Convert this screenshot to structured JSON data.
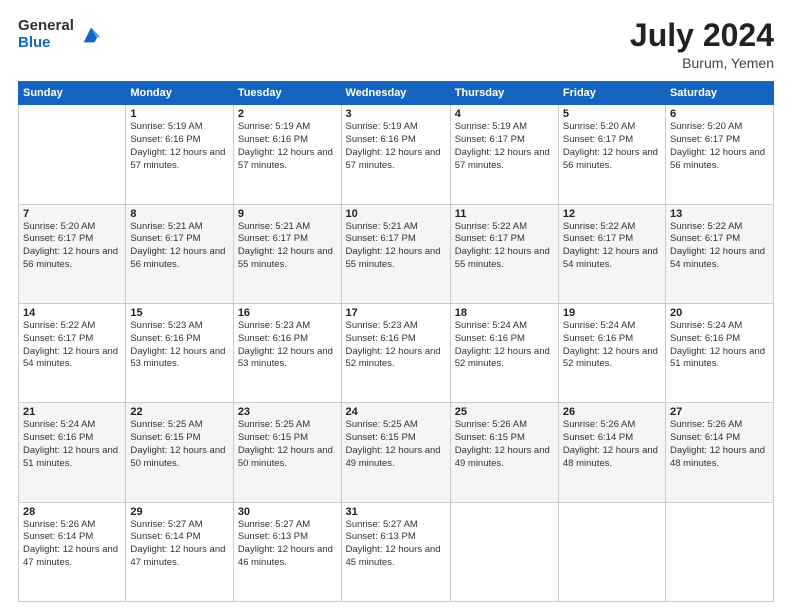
{
  "logo": {
    "general": "General",
    "blue": "Blue"
  },
  "title": {
    "month_year": "July 2024",
    "location": "Burum, Yemen"
  },
  "weekdays": [
    "Sunday",
    "Monday",
    "Tuesday",
    "Wednesday",
    "Thursday",
    "Friday",
    "Saturday"
  ],
  "weeks": [
    [
      {
        "day": "",
        "sunrise": "",
        "sunset": "",
        "daylight": ""
      },
      {
        "day": "1",
        "sunrise": "Sunrise: 5:19 AM",
        "sunset": "Sunset: 6:16 PM",
        "daylight": "Daylight: 12 hours and 57 minutes."
      },
      {
        "day": "2",
        "sunrise": "Sunrise: 5:19 AM",
        "sunset": "Sunset: 6:16 PM",
        "daylight": "Daylight: 12 hours and 57 minutes."
      },
      {
        "day": "3",
        "sunrise": "Sunrise: 5:19 AM",
        "sunset": "Sunset: 6:16 PM",
        "daylight": "Daylight: 12 hours and 57 minutes."
      },
      {
        "day": "4",
        "sunrise": "Sunrise: 5:19 AM",
        "sunset": "Sunset: 6:17 PM",
        "daylight": "Daylight: 12 hours and 57 minutes."
      },
      {
        "day": "5",
        "sunrise": "Sunrise: 5:20 AM",
        "sunset": "Sunset: 6:17 PM",
        "daylight": "Daylight: 12 hours and 56 minutes."
      },
      {
        "day": "6",
        "sunrise": "Sunrise: 5:20 AM",
        "sunset": "Sunset: 6:17 PM",
        "daylight": "Daylight: 12 hours and 56 minutes."
      }
    ],
    [
      {
        "day": "7",
        "sunrise": "Sunrise: 5:20 AM",
        "sunset": "Sunset: 6:17 PM",
        "daylight": "Daylight: 12 hours and 56 minutes."
      },
      {
        "day": "8",
        "sunrise": "Sunrise: 5:21 AM",
        "sunset": "Sunset: 6:17 PM",
        "daylight": "Daylight: 12 hours and 56 minutes."
      },
      {
        "day": "9",
        "sunrise": "Sunrise: 5:21 AM",
        "sunset": "Sunset: 6:17 PM",
        "daylight": "Daylight: 12 hours and 55 minutes."
      },
      {
        "day": "10",
        "sunrise": "Sunrise: 5:21 AM",
        "sunset": "Sunset: 6:17 PM",
        "daylight": "Daylight: 12 hours and 55 minutes."
      },
      {
        "day": "11",
        "sunrise": "Sunrise: 5:22 AM",
        "sunset": "Sunset: 6:17 PM",
        "daylight": "Daylight: 12 hours and 55 minutes."
      },
      {
        "day": "12",
        "sunrise": "Sunrise: 5:22 AM",
        "sunset": "Sunset: 6:17 PM",
        "daylight": "Daylight: 12 hours and 54 minutes."
      },
      {
        "day": "13",
        "sunrise": "Sunrise: 5:22 AM",
        "sunset": "Sunset: 6:17 PM",
        "daylight": "Daylight: 12 hours and 54 minutes."
      }
    ],
    [
      {
        "day": "14",
        "sunrise": "Sunrise: 5:22 AM",
        "sunset": "Sunset: 6:17 PM",
        "daylight": "Daylight: 12 hours and 54 minutes."
      },
      {
        "day": "15",
        "sunrise": "Sunrise: 5:23 AM",
        "sunset": "Sunset: 6:16 PM",
        "daylight": "Daylight: 12 hours and 53 minutes."
      },
      {
        "day": "16",
        "sunrise": "Sunrise: 5:23 AM",
        "sunset": "Sunset: 6:16 PM",
        "daylight": "Daylight: 12 hours and 53 minutes."
      },
      {
        "day": "17",
        "sunrise": "Sunrise: 5:23 AM",
        "sunset": "Sunset: 6:16 PM",
        "daylight": "Daylight: 12 hours and 52 minutes."
      },
      {
        "day": "18",
        "sunrise": "Sunrise: 5:24 AM",
        "sunset": "Sunset: 6:16 PM",
        "daylight": "Daylight: 12 hours and 52 minutes."
      },
      {
        "day": "19",
        "sunrise": "Sunrise: 5:24 AM",
        "sunset": "Sunset: 6:16 PM",
        "daylight": "Daylight: 12 hours and 52 minutes."
      },
      {
        "day": "20",
        "sunrise": "Sunrise: 5:24 AM",
        "sunset": "Sunset: 6:16 PM",
        "daylight": "Daylight: 12 hours and 51 minutes."
      }
    ],
    [
      {
        "day": "21",
        "sunrise": "Sunrise: 5:24 AM",
        "sunset": "Sunset: 6:16 PM",
        "daylight": "Daylight: 12 hours and 51 minutes."
      },
      {
        "day": "22",
        "sunrise": "Sunrise: 5:25 AM",
        "sunset": "Sunset: 6:15 PM",
        "daylight": "Daylight: 12 hours and 50 minutes."
      },
      {
        "day": "23",
        "sunrise": "Sunrise: 5:25 AM",
        "sunset": "Sunset: 6:15 PM",
        "daylight": "Daylight: 12 hours and 50 minutes."
      },
      {
        "day": "24",
        "sunrise": "Sunrise: 5:25 AM",
        "sunset": "Sunset: 6:15 PM",
        "daylight": "Daylight: 12 hours and 49 minutes."
      },
      {
        "day": "25",
        "sunrise": "Sunrise: 5:26 AM",
        "sunset": "Sunset: 6:15 PM",
        "daylight": "Daylight: 12 hours and 49 minutes."
      },
      {
        "day": "26",
        "sunrise": "Sunrise: 5:26 AM",
        "sunset": "Sunset: 6:14 PM",
        "daylight": "Daylight: 12 hours and 48 minutes."
      },
      {
        "day": "27",
        "sunrise": "Sunrise: 5:26 AM",
        "sunset": "Sunset: 6:14 PM",
        "daylight": "Daylight: 12 hours and 48 minutes."
      }
    ],
    [
      {
        "day": "28",
        "sunrise": "Sunrise: 5:26 AM",
        "sunset": "Sunset: 6:14 PM",
        "daylight": "Daylight: 12 hours and 47 minutes."
      },
      {
        "day": "29",
        "sunrise": "Sunrise: 5:27 AM",
        "sunset": "Sunset: 6:14 PM",
        "daylight": "Daylight: 12 hours and 47 minutes."
      },
      {
        "day": "30",
        "sunrise": "Sunrise: 5:27 AM",
        "sunset": "Sunset: 6:13 PM",
        "daylight": "Daylight: 12 hours and 46 minutes."
      },
      {
        "day": "31",
        "sunrise": "Sunrise: 5:27 AM",
        "sunset": "Sunset: 6:13 PM",
        "daylight": "Daylight: 12 hours and 45 minutes."
      },
      {
        "day": "",
        "sunrise": "",
        "sunset": "",
        "daylight": ""
      },
      {
        "day": "",
        "sunrise": "",
        "sunset": "",
        "daylight": ""
      },
      {
        "day": "",
        "sunrise": "",
        "sunset": "",
        "daylight": ""
      }
    ]
  ]
}
